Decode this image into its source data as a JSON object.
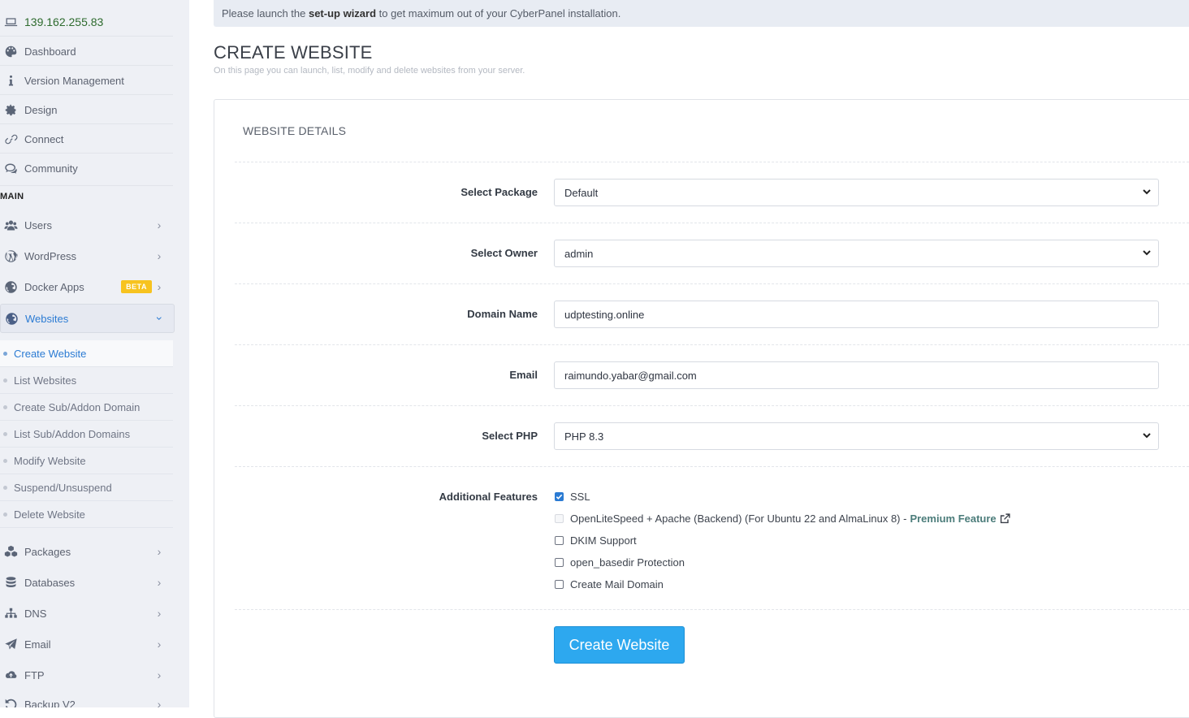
{
  "sidebar": {
    "server_ip": "139.162.255.83",
    "top_items": [
      {
        "label": "Dashboard",
        "icon": "palette-icon"
      },
      {
        "label": "Version Management",
        "icon": "info-icon"
      },
      {
        "label": "Design",
        "icon": "gear-icon"
      },
      {
        "label": "Connect",
        "icon": "link-icon"
      },
      {
        "label": "Community",
        "icon": "chat-icon"
      }
    ],
    "section_label": "MAIN",
    "main_items": [
      {
        "label": "Users",
        "icon": "users-icon"
      },
      {
        "label": "WordPress",
        "icon": "wordpress-icon"
      },
      {
        "label": "Docker Apps",
        "icon": "globe-icon",
        "badge": "BETA"
      },
      {
        "label": "Websites",
        "icon": "globe-icon"
      }
    ],
    "websites_submenu": [
      "Create Website",
      "List Websites",
      "Create Sub/Addon Domain",
      "List Sub/Addon Domains",
      "Modify Website",
      "Suspend/Unsuspend",
      "Delete Website"
    ],
    "lower_items": [
      {
        "label": "Packages",
        "icon": "cubes-icon"
      },
      {
        "label": "Databases",
        "icon": "database-icon"
      },
      {
        "label": "DNS",
        "icon": "sitemap-icon"
      },
      {
        "label": "Email",
        "icon": "paper-plane-icon"
      },
      {
        "label": "FTP",
        "icon": "cloud-upload-icon"
      },
      {
        "label": "Backup V2",
        "icon": "backup-icon"
      }
    ]
  },
  "notice": {
    "prefix": "Please launch the ",
    "link": "set-up wizard",
    "suffix": " to get maximum out of your CyberPanel installation."
  },
  "page": {
    "title": "CREATE WEBSITE",
    "subtitle": "On this page you can launch, list, modify and delete websites from your server."
  },
  "form": {
    "section_title": "WEBSITE DETAILS",
    "package_label": "Select Package",
    "package_value": "Default",
    "owner_label": "Select Owner",
    "owner_value": "admin",
    "domain_label": "Domain Name",
    "domain_value": "udptesting.online",
    "email_label": "Email",
    "email_value": "raimundo.yabar@gmail.com",
    "php_label": "Select PHP",
    "php_value": "PHP 8.3",
    "features_label": "Additional Features",
    "features": [
      {
        "label": "SSL",
        "checked": true,
        "disabled": false
      },
      {
        "label": "OpenLiteSpeed + Apache (Backend) (For Ubuntu 22 and AlmaLinux 8) -",
        "checked": false,
        "disabled": true,
        "extra": "Premium Feature"
      },
      {
        "label": "DKIM Support",
        "checked": false,
        "disabled": false
      },
      {
        "label": "open_basedir Protection",
        "checked": false,
        "disabled": false
      },
      {
        "label": "Create Mail Domain",
        "checked": false,
        "disabled": false
      }
    ],
    "submit_label": "Create Website"
  },
  "colors": {
    "accent": "#2b7bd3",
    "button": "#2da8ef",
    "sidebar_bg": "#eef0f5",
    "beta_badge": "#f7c31f",
    "premium": "#4b7c7a"
  }
}
